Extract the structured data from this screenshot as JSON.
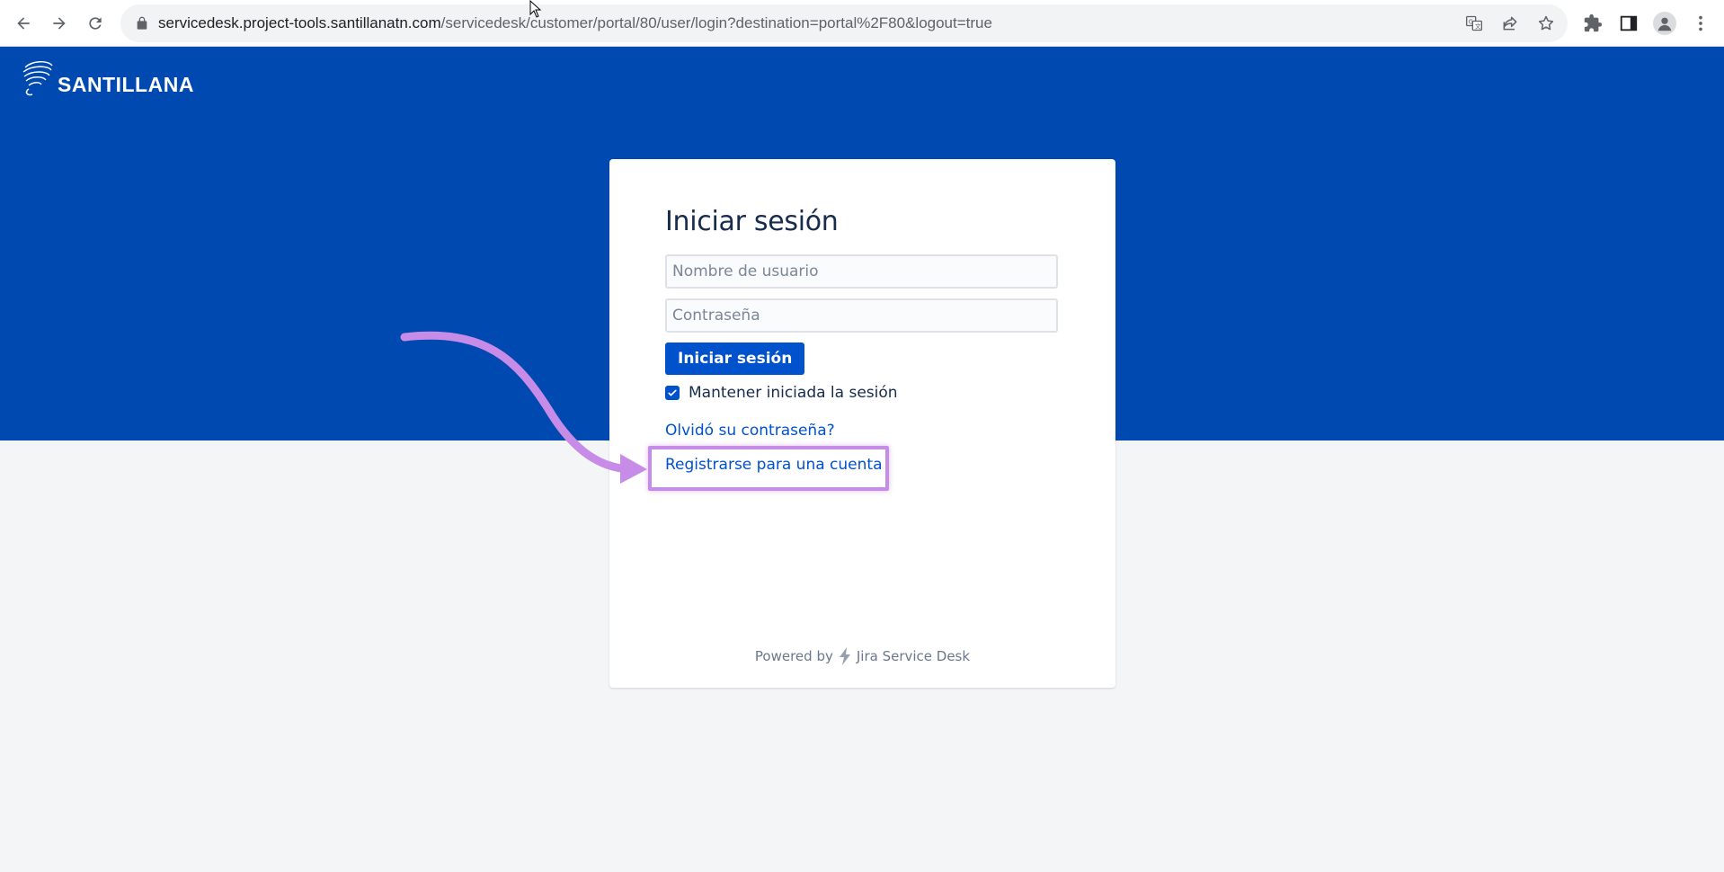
{
  "browser": {
    "url_host": "servicedesk.project-tools.santillanatn.com",
    "url_path": "/servicedesk/customer/portal/80/user/login?destination=portal%2F80&logout=true",
    "icons": [
      "back-icon",
      "forward-icon",
      "reload-icon",
      "lock-icon",
      "translate-icon",
      "share-icon",
      "bookmark-star-icon",
      "extensions-icon",
      "side-panel-icon",
      "profile-icon",
      "menu-kebab-icon"
    ]
  },
  "brand": {
    "logo_text": "SANTILLANA",
    "hero_color": "#0049b0"
  },
  "login": {
    "title": "Iniciar sesión",
    "username_placeholder": "Nombre de usuario",
    "password_placeholder": "Contraseña",
    "submit_label": "Iniciar sesión",
    "remember_label": "Mantener iniciada la sesión",
    "remember_checked": true,
    "forgot_link": "Olvidó su contraseña?",
    "register_link": "Registrarse para una cuenta"
  },
  "footer": {
    "powered_prefix": "Powered by",
    "powered_product": "Jira Service Desk"
  },
  "annotation": {
    "color": "#c78be8"
  }
}
